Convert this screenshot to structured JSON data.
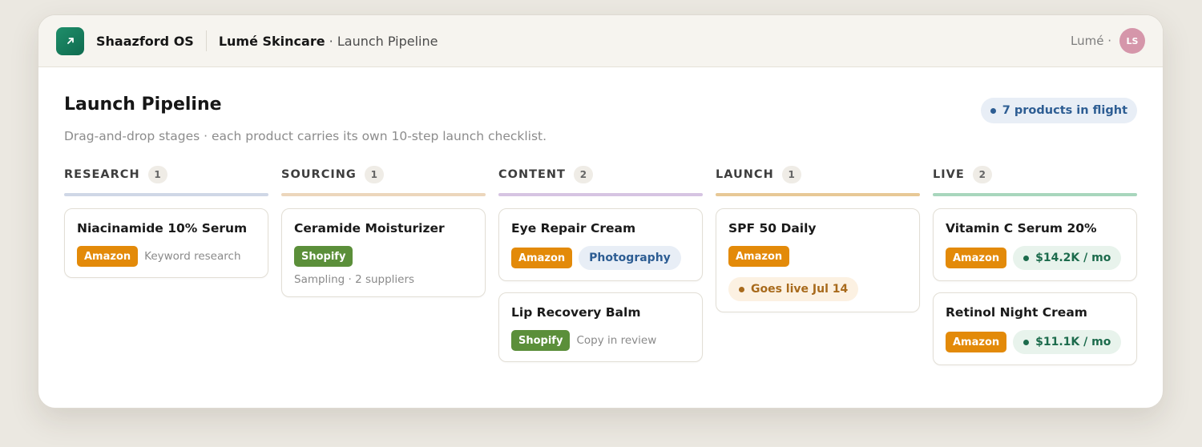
{
  "app": {
    "name": "Shaazford OS",
    "logo_icon": "arrow-up-right-icon",
    "accent": "#157a5a"
  },
  "breadcrumb": {
    "workspace": "Lumé Skincare",
    "separator": "·",
    "page": "Launch Pipeline"
  },
  "user": {
    "name": "Lumé ·",
    "initials": "LS",
    "avatar_color": "#d596aa"
  },
  "page": {
    "title": "Launch Pipeline",
    "subtitle": "Drag-and-drop stages · each product carries its own 10-step launch checklist.",
    "in_flight": "7 products in flight"
  },
  "columns": [
    {
      "name": "RESEARCH",
      "count": "1",
      "color": "#cfd7e6",
      "cards": [
        {
          "title": "Niacinamide 10% Serum",
          "tag": "Amazon",
          "note": "Keyword research"
        }
      ]
    },
    {
      "name": "SOURCING",
      "count": "1",
      "color": "#ecd6bc",
      "cards": [
        {
          "title": "Ceramide Moisturizer",
          "tag": "Shopify",
          "note": "Sampling · 2 suppliers"
        }
      ]
    },
    {
      "name": "CONTENT",
      "count": "2",
      "color": "#d6c4e2",
      "cards": [
        {
          "title": "Eye Repair Cream",
          "tag": "Amazon",
          "pill": "Photography"
        },
        {
          "title": "Lip Recovery Balm",
          "tag": "Shopify",
          "note": "Copy in review"
        }
      ]
    },
    {
      "name": "LAUNCH",
      "count": "1",
      "color": "#e7c896",
      "cards": [
        {
          "title": "SPF 50 Daily",
          "tag": "Amazon",
          "status": "Goes live Jul 14"
        }
      ]
    },
    {
      "name": "LIVE",
      "count": "2",
      "color": "#a8d6bd",
      "cards": [
        {
          "title": "Vitamin C Serum 20%",
          "tag": "Amazon",
          "revenue": "$14.2K / mo"
        },
        {
          "title": "Retinol Night Cream",
          "tag": "Amazon",
          "revenue": "$11.1K / mo"
        }
      ]
    }
  ],
  "colors": {
    "amazon": "#e38a09",
    "shopify": "#5b8f3a"
  }
}
